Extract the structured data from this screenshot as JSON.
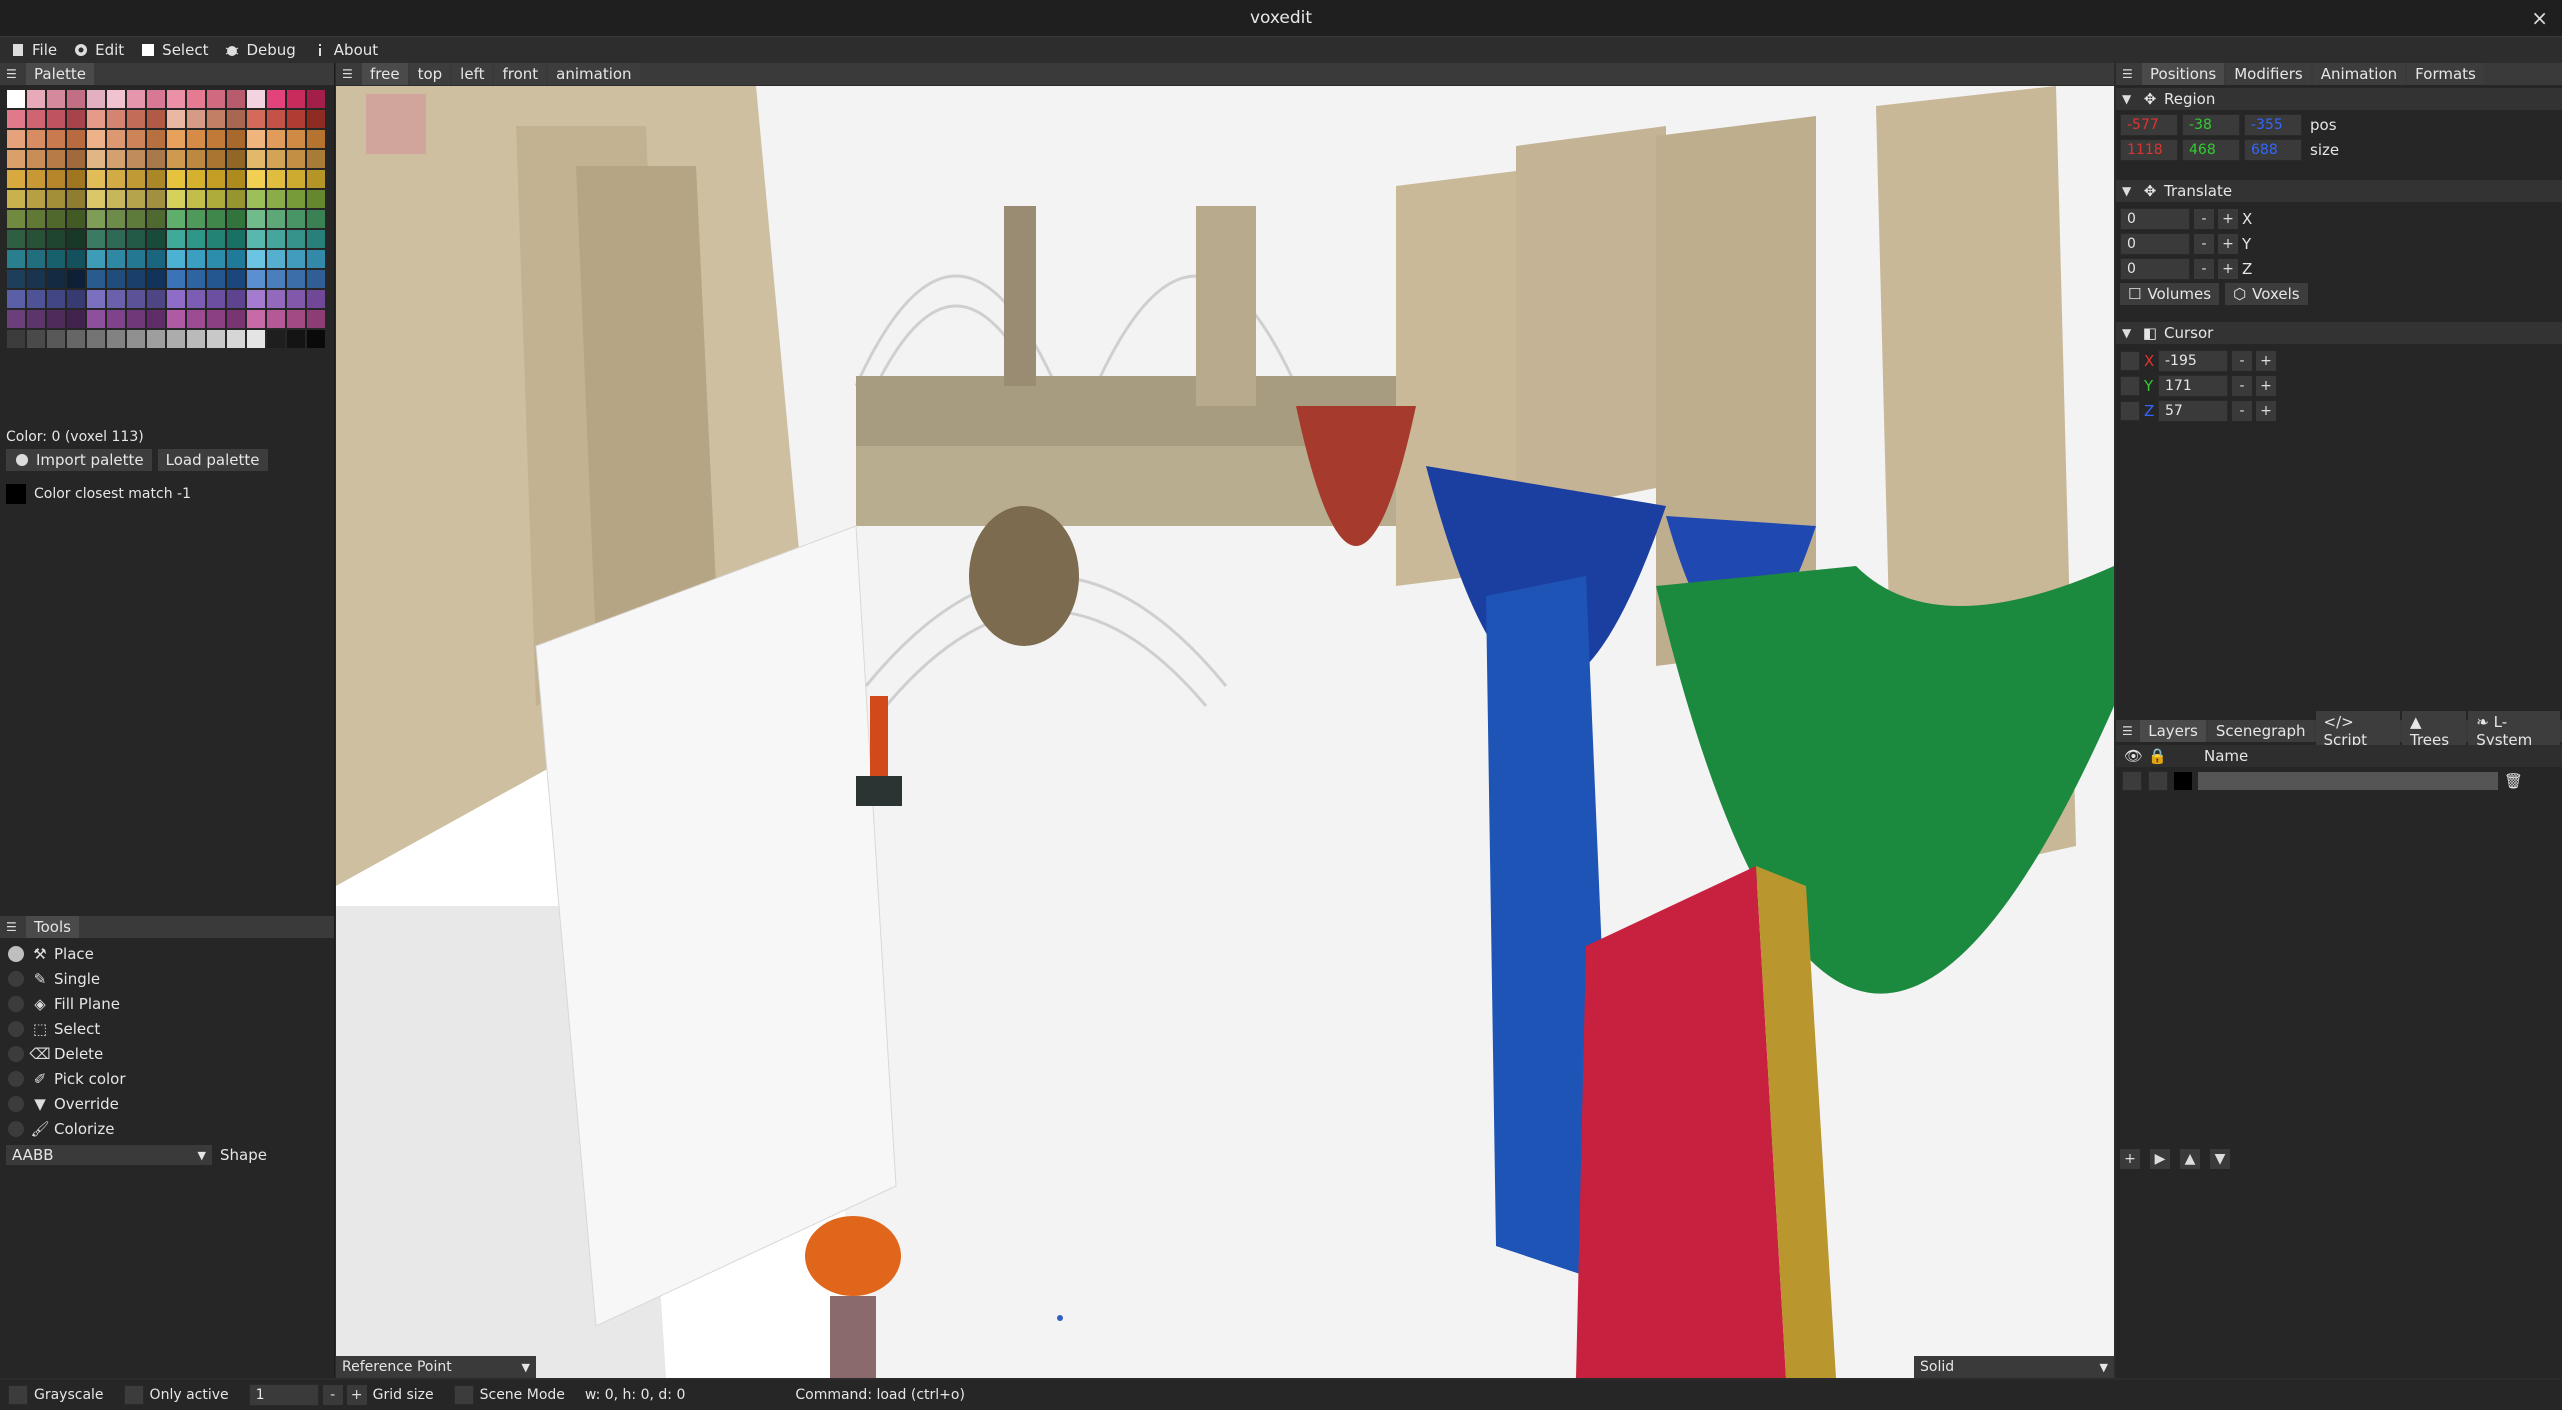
{
  "window": {
    "title": "voxedit",
    "close_glyph": "×"
  },
  "menu": [
    {
      "label": "File",
      "icon": "file-icon"
    },
    {
      "label": "Edit",
      "icon": "gear-icon"
    },
    {
      "label": "Select",
      "icon": "checkbox-icon"
    },
    {
      "label": "Debug",
      "icon": "bug-icon"
    },
    {
      "label": "About",
      "icon": "info-icon"
    }
  ],
  "palette_panel": {
    "tab": "Palette",
    "color_info": "Color: 0 (voxel 113)",
    "import_label": "Import palette",
    "load_label": "Load palette",
    "closest_match": "Color closest match  -1",
    "colors": [
      "#ffffff",
      "#e8a9b8",
      "#d4899c",
      "#c26e85",
      "#e3b0c2",
      "#f1c2cf",
      "#e596ad",
      "#d97895",
      "#eb90a6",
      "#e57b92",
      "#cf6a80",
      "#b95b6e",
      "#f3d3df",
      "#e4427a",
      "#c92b5c",
      "#a31e48",
      "#e07a8a",
      "#d06473",
      "#c05360",
      "#a8434c",
      "#e59b88",
      "#d58472",
      "#c36c58",
      "#b15a46",
      "#e9b7a2",
      "#d59b84",
      "#c37f65",
      "#a96650",
      "#d46b5a",
      "#c45246",
      "#b03c33",
      "#8e2c24",
      "#e6a37b",
      "#d88c62",
      "#c97a4f",
      "#b86a40",
      "#eeb28a",
      "#dc9870",
      "#cc8458",
      "#b8703f",
      "#e7a15c",
      "#d68b46",
      "#c27a38",
      "#a9692d",
      "#f0b57c",
      "#e19c5c",
      "#cf8a44",
      "#b4742f",
      "#d9a06a",
      "#c98d58",
      "#b77b48",
      "#a26a3c",
      "#e2b585",
      "#d3a06f",
      "#c08c5c",
      "#a97949",
      "#cf9a50",
      "#bd8840",
      "#a97632",
      "#926625",
      "#e2b96b",
      "#d3a456",
      "#c29044",
      "#a87c36",
      "#d7a93f",
      "#c79834",
      "#b5872a",
      "#a07621",
      "#e2bd57",
      "#d2ab45",
      "#bf9a35",
      "#aa8828",
      "#e6c33c",
      "#d6b12e",
      "#c59f24",
      "#ad8c1d",
      "#f0cf52",
      "#e0bd3e",
      "#cdab2f",
      "#b49525",
      "#c9b24e",
      "#b7a043",
      "#a48f39",
      "#8f7d30",
      "#d9c76a",
      "#c8b65a",
      "#b6a44c",
      "#a0903f",
      "#d4d25a",
      "#c1bf49",
      "#aeac3b",
      "#97952f",
      "#9dbf5a",
      "#8aad49",
      "#789b3a",
      "#65872d",
      "#708a3f",
      "#607935",
      "#50682b",
      "#425a23",
      "#7e9d57",
      "#6e8c49",
      "#5e7b3c",
      "#4f6a31",
      "#5fae6c",
      "#4f9a5b",
      "#3f874b",
      "#31753d",
      "#6fbc8a",
      "#5ca877",
      "#4a9565",
      "#3a8254",
      "#2f5f43",
      "#285238",
      "#20452e",
      "#183925",
      "#3b7a63",
      "#2e6a55",
      "#225a47",
      "#184b3a",
      "#3faa9a",
      "#2f9788",
      "#238476",
      "#197165",
      "#58b8b0",
      "#46a59d",
      "#36938b",
      "#278079",
      "#2a7f8f",
      "#216f7e",
      "#19606d",
      "#12515d",
      "#3d9cb8",
      "#2f89a4",
      "#247891",
      "#1a667e",
      "#4cb2d4",
      "#3b9fc1",
      "#2c8dad",
      "#1f7b99",
      "#6ac4e2",
      "#55b0cf",
      "#429dbc",
      "#328aa8",
      "#1e3f5c",
      "#18344f",
      "#122a42",
      "#0d2036",
      "#2a5b8f",
      "#214d7d",
      "#19406b",
      "#12345a",
      "#3b73b8",
      "#2f64a3",
      "#245690",
      "#1a487d",
      "#5a8fd1",
      "#4b7ebd",
      "#3c6ea9",
      "#2f5f95",
      "#5b5fa8",
      "#4e5296",
      "#424684",
      "#373b72",
      "#7b6fc0",
      "#6b60ac",
      "#5c5298",
      "#4e4585",
      "#8e6cc7",
      "#7d5db4",
      "#6d4fa1",
      "#5e438e",
      "#a57bd0",
      "#9369bd",
      "#8158aa",
      "#704897",
      "#6b3f7a",
      "#5d356b",
      "#4f2b5c",
      "#42234e",
      "#8e4f9d",
      "#7e438b",
      "#6e3879",
      "#5f2e68",
      "#b05aa5",
      "#9d4c93",
      "#8a4082",
      "#783571",
      "#c96aa8",
      "#b55996",
      "#a14a84",
      "#8d3d73",
      "#3c3c3c",
      "#4a4a4a",
      "#585858",
      "#666666",
      "#747474",
      "#828282",
      "#909090",
      "#9e9e9e",
      "#acacac",
      "#bababa",
      "#c8c8c8",
      "#d6d6d6",
      "#e4e4e4",
      "#1e1e1e",
      "#141414",
      "#0a0a0a"
    ]
  },
  "tools_panel": {
    "tab": "Tools",
    "items": [
      "Place",
      "Single",
      "Fill Plane",
      "Select",
      "Delete",
      "Pick color",
      "Override",
      "Colorize"
    ],
    "shape_value": "AABB",
    "shape_label": "Shape"
  },
  "viewport": {
    "tabs": [
      "free",
      "top",
      "left",
      "front",
      "animation"
    ],
    "reference_point": "Reference Point",
    "render_mode": "Solid"
  },
  "right_top": {
    "tabs": [
      "Positions",
      "Modifiers",
      "Animation",
      "Formats"
    ],
    "region": {
      "header": "Region",
      "pos": [
        "-577",
        "-38",
        "-355"
      ],
      "pos_label": "pos",
      "size": [
        "1118",
        "468",
        "688"
      ],
      "size_label": "size"
    },
    "translate": {
      "header": "Translate",
      "rows": [
        {
          "value": "0",
          "axis": "X"
        },
        {
          "value": "0",
          "axis": "Y"
        },
        {
          "value": "0",
          "axis": "Z"
        }
      ],
      "volumes_label": "Volumes",
      "voxels_label": "Voxels"
    },
    "cursor": {
      "header": "Cursor",
      "rows": [
        {
          "axis": "X",
          "value": "-195"
        },
        {
          "axis": "Y",
          "value": "171"
        },
        {
          "axis": "Z",
          "value": "57"
        }
      ]
    }
  },
  "layers_panel": {
    "tabs": [
      "Layers",
      "Scenegraph",
      "Script",
      "Trees",
      "L-System"
    ],
    "name_col": "Name"
  },
  "statusbar": {
    "grayscale": "Grayscale",
    "only_active": "Only active",
    "grid_value": "1",
    "grid_size": "Grid size",
    "scene_mode": "Scene Mode",
    "dims": "w: 0, h: 0, d: 0",
    "command": "Command: load (ctrl+o)"
  }
}
